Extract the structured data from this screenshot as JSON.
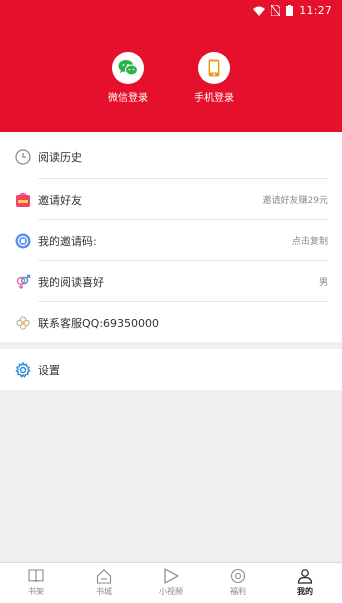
{
  "status_bar": {
    "time": "11:27"
  },
  "login": {
    "wechat_label": "微信登录",
    "phone_label": "手机登录"
  },
  "menu": {
    "history": {
      "label": "阅读历史"
    },
    "invite": {
      "label": "邀请好友",
      "value": "邀请好友赚29元"
    },
    "invite_code": {
      "label": "我的邀请码:",
      "value": "点击复制"
    },
    "preference": {
      "label": "我的阅读喜好",
      "value": "男"
    },
    "service": {
      "label": "联系客服QQ:69350000"
    },
    "settings": {
      "label": "设置"
    }
  },
  "tabs": [
    {
      "label": "书架",
      "icon": "book-icon"
    },
    {
      "label": "书城",
      "icon": "home-icon"
    },
    {
      "label": "小视频",
      "icon": "play-icon"
    },
    {
      "label": "福利",
      "icon": "coin-icon"
    },
    {
      "label": "我的",
      "icon": "user-icon",
      "active": true
    }
  ],
  "colors": {
    "brand_red": "#e5112c",
    "wechat_green": "#2bb24c",
    "phone_orange": "#f29a1a"
  }
}
